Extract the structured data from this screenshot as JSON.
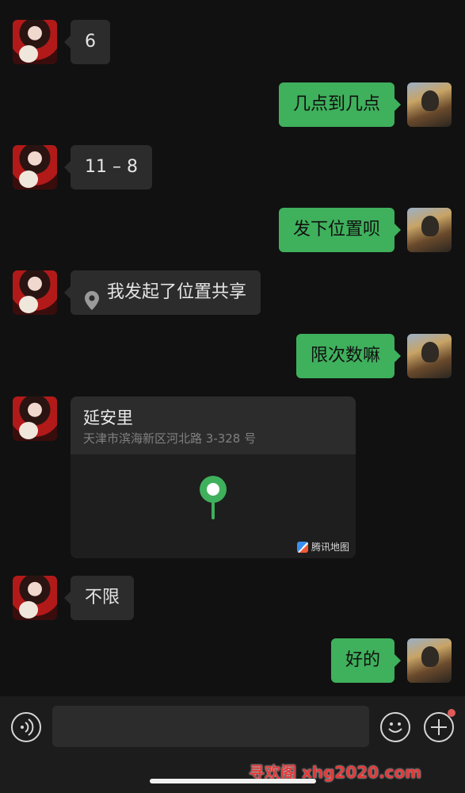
{
  "messages": [
    {
      "side": "left",
      "text": "6"
    },
    {
      "side": "right",
      "text": "几点到几点"
    },
    {
      "side": "left",
      "text": "11 – 8"
    },
    {
      "side": "right",
      "text": "发下位置呗"
    },
    {
      "side": "left",
      "type": "location-share",
      "text": "我发起了位置共享"
    },
    {
      "side": "right",
      "text": "限次数嘛"
    },
    {
      "side": "left",
      "type": "location",
      "title": "延安里",
      "address": "天津市滨海新区河北路 3-328 号",
      "brand": "腾讯地图"
    },
    {
      "side": "left",
      "text": "不限"
    },
    {
      "side": "right",
      "text": "好的"
    }
  ],
  "input_bar": {
    "placeholder": "",
    "icons": [
      "voice-icon",
      "emoji-icon",
      "plus-icon"
    ]
  },
  "watermark": "寻欢阁 xhg2020.com",
  "colors": {
    "background": "#111111",
    "incoming_bubble": "#2c2c2c",
    "outgoing_bubble": "#3fb05c",
    "pin_green": "#3fb05c",
    "badge_red": "#e05a5a"
  }
}
